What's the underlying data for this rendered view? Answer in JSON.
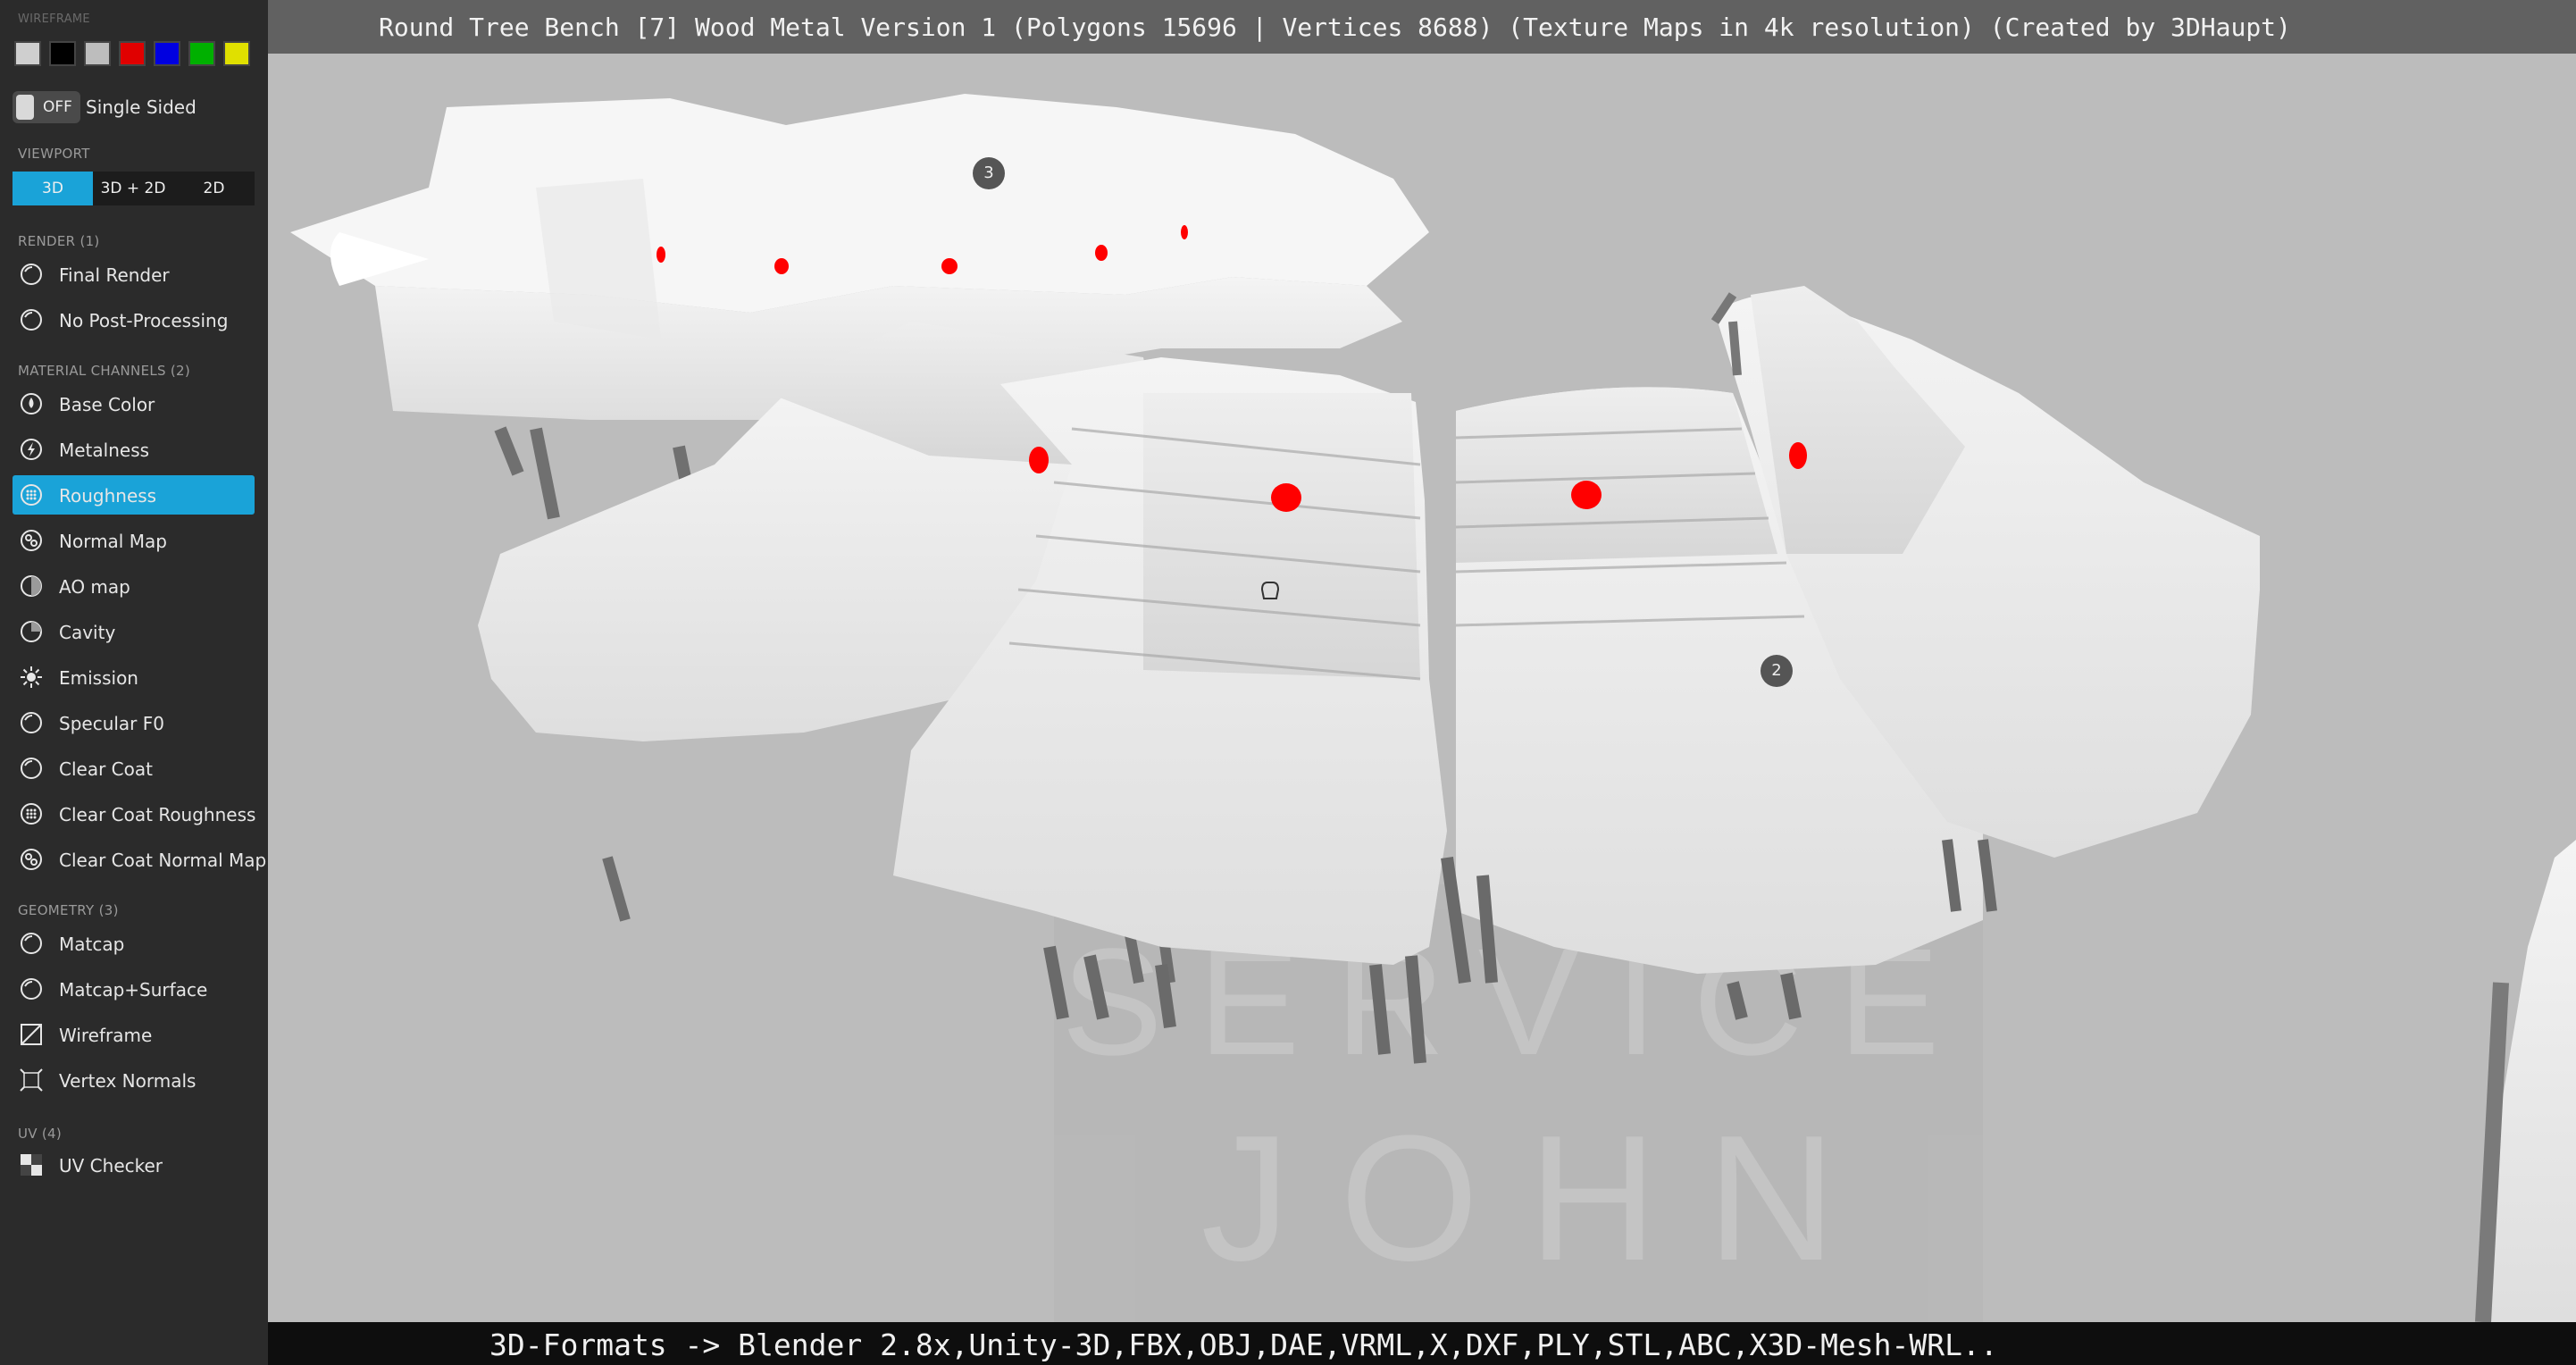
{
  "title": "Round Tree Bench [7] Wood Metal Version 1 (Polygons 15696 | Vertices 8688) (Texture Maps in 4k resolution) (Created by 3DHaupt)",
  "sidebar": {
    "wireframe": {
      "label": "WIREFRAME",
      "swatches": [
        {
          "name": "swatch-transparent",
          "color": "#cfcfcf"
        },
        {
          "name": "swatch-black",
          "color": "#000000"
        },
        {
          "name": "swatch-gray",
          "color": "#bdbdbd"
        },
        {
          "name": "swatch-red",
          "color": "#e00000"
        },
        {
          "name": "swatch-blue",
          "color": "#0000e0"
        },
        {
          "name": "swatch-green",
          "color": "#00b000"
        },
        {
          "name": "swatch-yellow",
          "color": "#e0e000"
        }
      ]
    },
    "single_sided": {
      "toggle_state": "OFF",
      "label": "Single Sided"
    },
    "viewport": {
      "label": "VIEWPORT",
      "options": [
        "3D",
        "3D + 2D",
        "2D"
      ],
      "active": "3D"
    },
    "render": {
      "label": "RENDER (1)",
      "items": [
        {
          "label": "Final Render",
          "icon": "sphere-icon"
        },
        {
          "label": "No Post-Processing",
          "icon": "sphere-icon"
        }
      ]
    },
    "material": {
      "label": "MATERIAL CHANNELS (2)",
      "items": [
        {
          "label": "Base Color",
          "icon": "drop-icon"
        },
        {
          "label": "Metalness",
          "icon": "lightning-icon"
        },
        {
          "label": "Roughness",
          "icon": "dots-sphere-icon"
        },
        {
          "label": "Normal Map",
          "icon": "normal-map-icon"
        },
        {
          "label": "AO map",
          "icon": "half-sphere-icon"
        },
        {
          "label": "Cavity",
          "icon": "cavity-icon"
        },
        {
          "label": "Emission",
          "icon": "sun-icon"
        },
        {
          "label": "Specular F0",
          "icon": "sphere-icon"
        },
        {
          "label": "Clear Coat",
          "icon": "sphere-icon"
        },
        {
          "label": "Clear Coat Roughness",
          "icon": "dots-sphere-icon"
        },
        {
          "label": "Clear Coat Normal Map",
          "icon": "normal-map-icon"
        }
      ],
      "active": "Roughness"
    },
    "geometry": {
      "label": "GEOMETRY (3)",
      "items": [
        {
          "label": "Matcap",
          "icon": "sphere-icon"
        },
        {
          "label": "Matcap+Surface",
          "icon": "sphere-icon"
        },
        {
          "label": "Wireframe",
          "icon": "wireframe-icon"
        },
        {
          "label": "Vertex Normals",
          "icon": "vertex-normals-icon"
        }
      ]
    },
    "uv": {
      "label": "UV (4)",
      "items": [
        {
          "label": "UV Checker",
          "icon": "checker-icon"
        }
      ]
    },
    "accent_color": "#1aa3d8"
  },
  "viewport": {
    "background": "#bdbdbd",
    "watermark": {
      "line1": "SERVICE",
      "line2": "J O H N"
    },
    "annotations": [
      "3",
      "2"
    ],
    "marker_color": "#ff0000"
  },
  "footer": {
    "formats": "3D-Formats -> Blender 2.8x,Unity-3D,FBX,OBJ,DAE,VRML,X,DXF,PLY,STL,ABC,X3D-Mesh-WRL.."
  }
}
